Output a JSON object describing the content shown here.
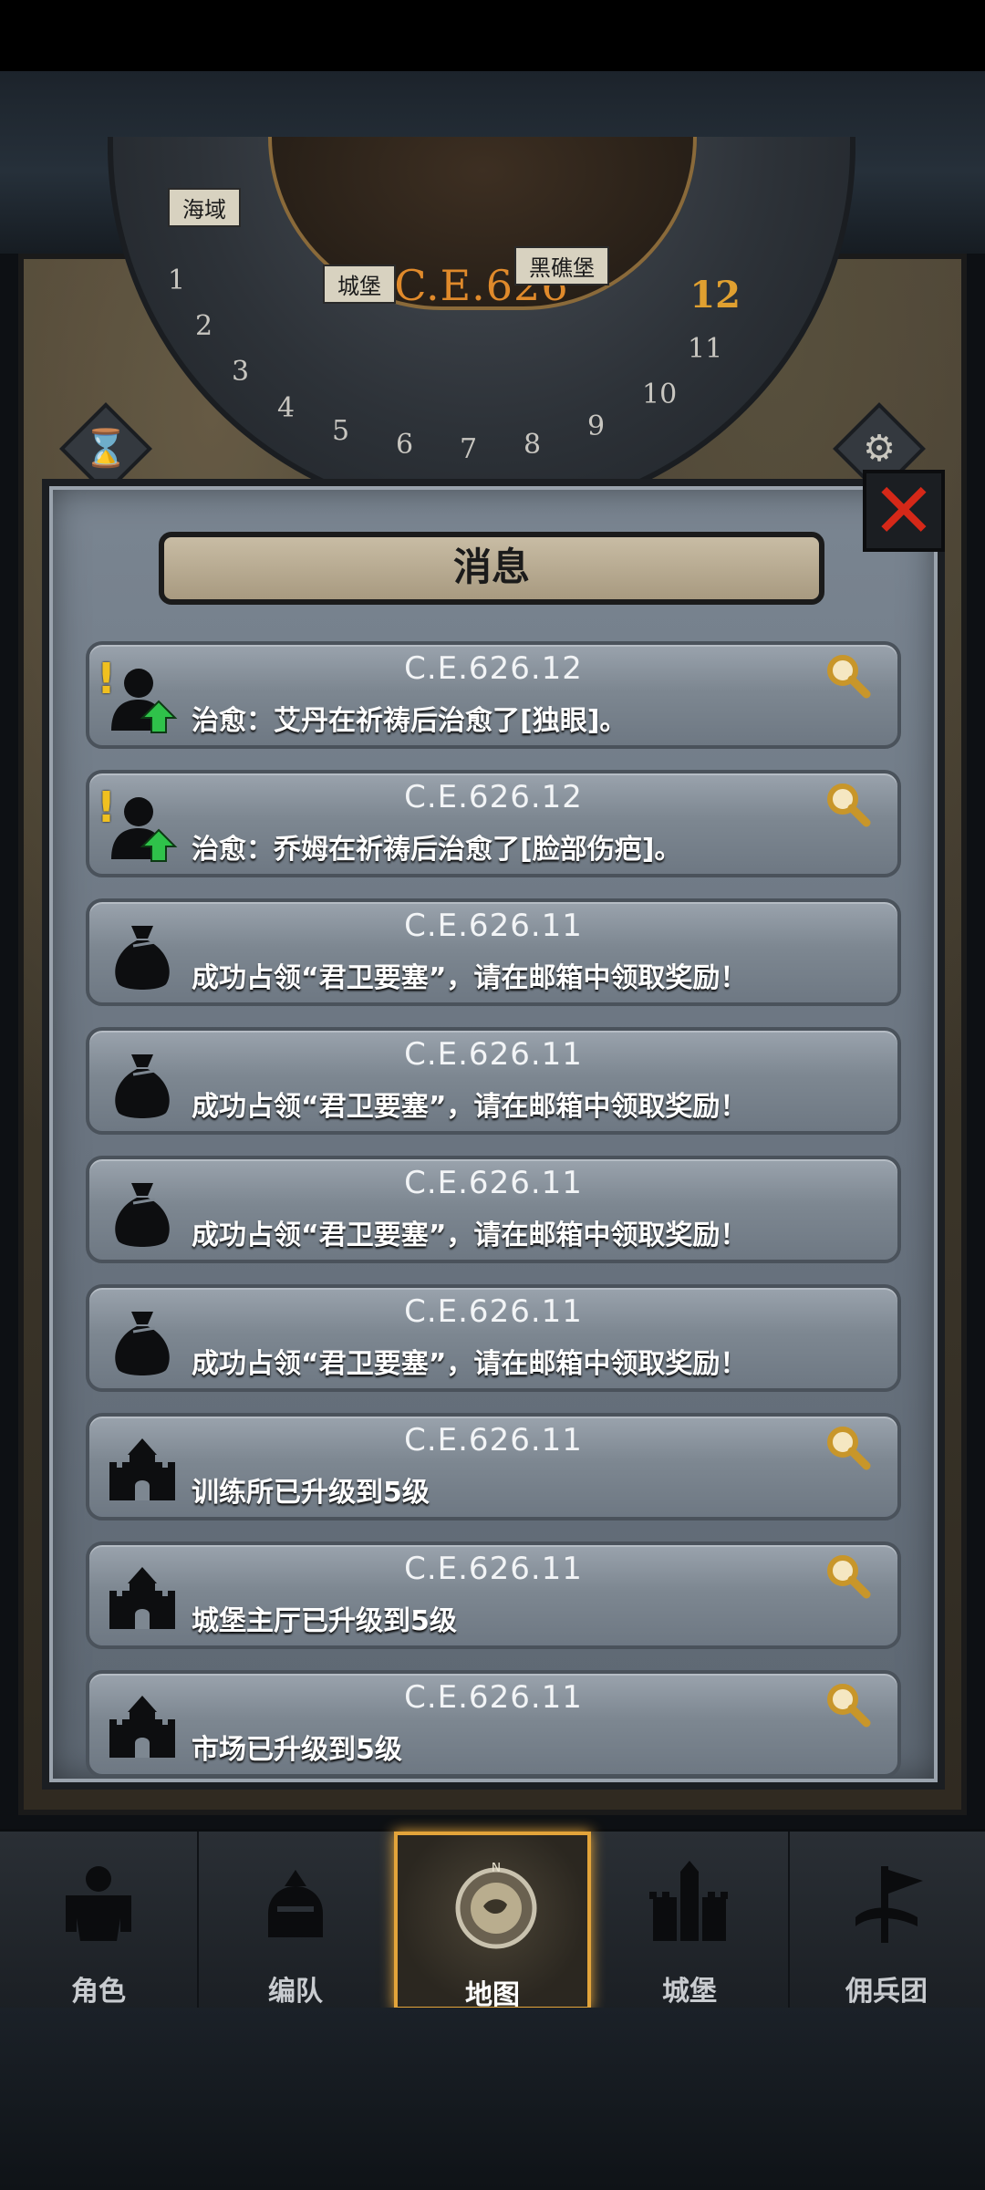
{
  "calendar": {
    "year": "C.E.626",
    "month": "12",
    "location_left": "海域",
    "location_castle": "城堡",
    "location_right": "黑礁堡",
    "numbers": [
      "1",
      "2",
      "3",
      "4",
      "5",
      "6",
      "7",
      "8",
      "9",
      "10",
      "11"
    ]
  },
  "dialog": {
    "title": "消息",
    "close_label": "✕",
    "messages": [
      {
        "date": "C.E.626.12",
        "text": "治愈：艾丹在祈祷后治愈了[独眼]。",
        "icon": "healed-person-icon",
        "alert": true,
        "search": true
      },
      {
        "date": "C.E.626.12",
        "text": "治愈：乔姆在祈祷后治愈了[脸部伤疤]。",
        "icon": "healed-person-icon",
        "alert": true,
        "search": true
      },
      {
        "date": "C.E.626.11",
        "text": "成功占领“君卫要塞”，请在邮箱中领取奖励！",
        "icon": "loot-bag-icon",
        "alert": false,
        "search": false
      },
      {
        "date": "C.E.626.11",
        "text": "成功占领“君卫要塞”，请在邮箱中领取奖励！",
        "icon": "loot-bag-icon",
        "alert": false,
        "search": false
      },
      {
        "date": "C.E.626.11",
        "text": "成功占领“君卫要塞”，请在邮箱中领取奖励！",
        "icon": "loot-bag-icon",
        "alert": false,
        "search": false
      },
      {
        "date": "C.E.626.11",
        "text": "成功占领“君卫要塞”，请在邮箱中领取奖励！",
        "icon": "loot-bag-icon",
        "alert": false,
        "search": false
      },
      {
        "date": "C.E.626.11",
        "text": "训练所已升级到5级",
        "icon": "building-icon",
        "alert": false,
        "search": true
      },
      {
        "date": "C.E.626.11",
        "text": "城堡主厅已升级到5级",
        "icon": "building-icon",
        "alert": false,
        "search": true
      },
      {
        "date": "C.E.626.11",
        "text": "市场已升级到5级",
        "icon": "building-icon",
        "alert": false,
        "search": true
      }
    ]
  },
  "nav": {
    "items": [
      {
        "label": "角色",
        "icon": "knight-icon",
        "active": false
      },
      {
        "label": "编队",
        "icon": "helmet-icon",
        "active": false
      },
      {
        "label": "地图",
        "icon": "compass-map-icon",
        "active": true
      },
      {
        "label": "城堡",
        "icon": "castle-icon",
        "active": false
      },
      {
        "label": "佣兵团",
        "icon": "mercenary-banner-icon",
        "active": false
      }
    ]
  },
  "colors": {
    "accent_gold": "#e3a43a",
    "year_orange": "#e08a2b",
    "close_red": "#d52818",
    "alert_yellow": "#f0c020",
    "upgrade_green": "#2fc24a"
  }
}
